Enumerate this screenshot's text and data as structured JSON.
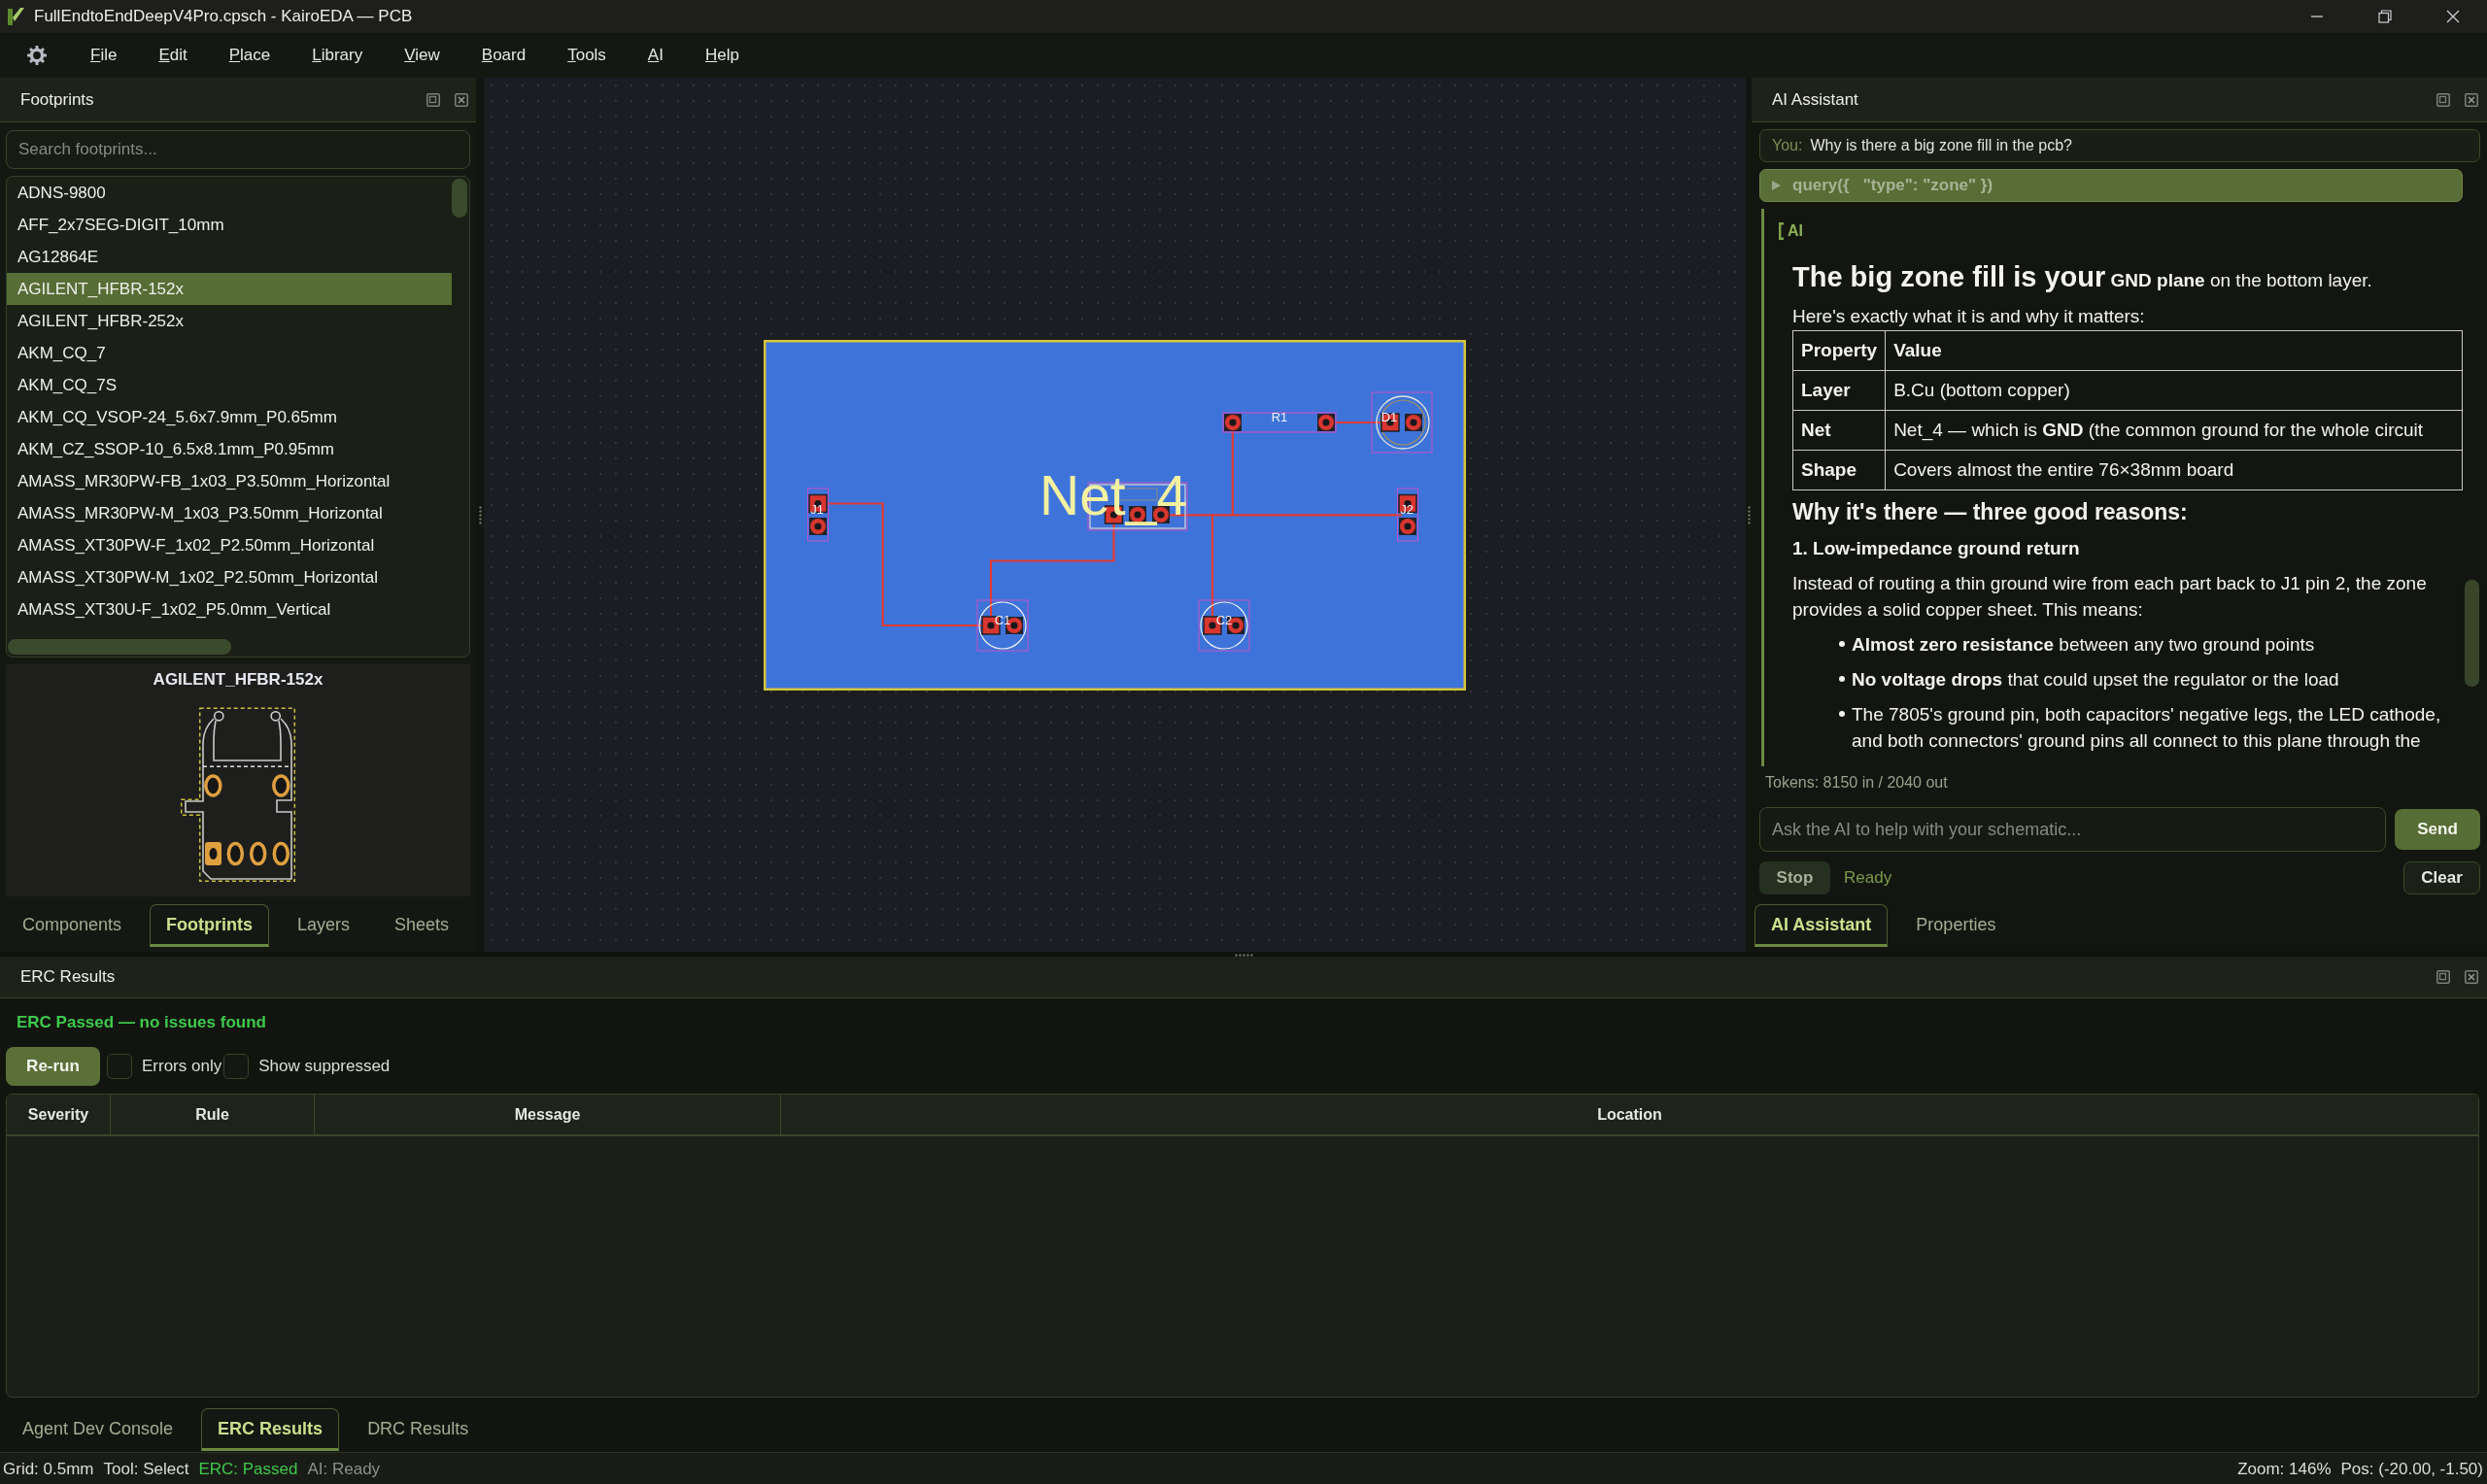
{
  "window": {
    "title": "FullEndtoEndDeepV4Pro.cpsch - KairoEDA — PCB"
  },
  "menu": [
    "File",
    "Edit",
    "Place",
    "Library",
    "View",
    "Board",
    "Tools",
    "AI",
    "Help"
  ],
  "footprints_panel": {
    "title": "Footprints",
    "search": {
      "placeholder": "Search footprints..."
    },
    "items": [
      {
        "label": "ADNS-9800",
        "selected": false
      },
      {
        "label": "AFF_2x7SEG-DIGIT_10mm",
        "selected": false
      },
      {
        "label": "AG12864E",
        "selected": false
      },
      {
        "label": "AGILENT_HFBR-152x",
        "selected": true
      },
      {
        "label": "AGILENT_HFBR-252x",
        "selected": false
      },
      {
        "label": "AKM_CQ_7",
        "selected": false
      },
      {
        "label": "AKM_CQ_7S",
        "selected": false
      },
      {
        "label": "AKM_CQ_VSOP-24_5.6x7.9mm_P0.65mm",
        "selected": false
      },
      {
        "label": "AKM_CZ_SSOP-10_6.5x8.1mm_P0.95mm",
        "selected": false
      },
      {
        "label": "AMASS_MR30PW-FB_1x03_P3.50mm_Horizontal",
        "selected": false
      },
      {
        "label": "AMASS_MR30PW-M_1x03_P3.50mm_Horizontal",
        "selected": false
      },
      {
        "label": "AMASS_XT30PW-F_1x02_P2.50mm_Horizontal",
        "selected": false
      },
      {
        "label": "AMASS_XT30PW-M_1x02_P2.50mm_Horizontal",
        "selected": false
      },
      {
        "label": "AMASS_XT30U-F_1x02_P5.0mm_Vertical",
        "selected": false
      }
    ],
    "preview": {
      "title": "AGILENT_HFBR-152x"
    },
    "tabs": [
      {
        "label": "Components",
        "selected": false
      },
      {
        "label": "Footprints",
        "selected": true
      },
      {
        "label": "Layers",
        "selected": false
      },
      {
        "label": "Sheets",
        "selected": false
      }
    ]
  },
  "pcb_canvas": {
    "net_label": "Net_4",
    "components": [
      {
        "ref": "R1",
        "kind": "resistor"
      },
      {
        "ref": "D1",
        "kind": "led"
      },
      {
        "ref": "J1",
        "kind": "connector"
      },
      {
        "kind": "regulator"
      },
      {
        "ref": "J2",
        "kind": "connector"
      },
      {
        "ref": "C1",
        "kind": "capacitor"
      },
      {
        "ref": "C2",
        "kind": "capacitor"
      }
    ]
  },
  "ai_panel": {
    "title": "AI Assistant",
    "user_message": {
      "speaker": "You:",
      "text": "Why is there a big zone fill in the pcb?"
    },
    "tool_call": {
      "text": "query({   \"type\": \"zone\" })",
      "expanded": false
    },
    "reply": {
      "speaker": "AI",
      "heading": {
        "lead": "The big zone fill is your",
        "rest": "**GND plane** on the bottom layer."
      },
      "intro": "Here's exactly what it is and why it matters:",
      "table": {
        "columns": [
          "Property",
          "Value"
        ],
        "rows": [
          [
            "Layer",
            "B.Cu (bottom copper)"
          ],
          [
            "Net",
            "Net_4 — which is **GND** (the common ground for the whole circuit"
          ],
          [
            "Shape",
            "Covers almost the entire 76×38mm board"
          ]
        ]
      },
      "section_title": "Why it's there — three good reasons:",
      "point_title": "1. Low-impedance ground return",
      "paragraph": "Instead of routing a thin ground wire from each part back to J1 pin 2, the zone provides a solid copper sheet. This means:",
      "bullets": [
        "**Almost zero resistance** between any two ground points",
        "**No voltage drops** that could upset the regulator or the load",
        "The 7805's ground pin, both capacitors' negative legs, the LED cathode, and both connectors' ground pins all connect to this plane through the"
      ]
    },
    "tokens": "Tokens: 8150 in / 2040 out",
    "input": {
      "placeholder": "Ask the AI to help with your schematic..."
    },
    "send_button": "Send",
    "stop_button": {
      "label": "Stop",
      "disabled": true
    },
    "status": "Ready",
    "clear_button": "Clear",
    "tabs": [
      {
        "label": "AI Assistant",
        "selected": true
      },
      {
        "label": "Properties",
        "selected": false
      }
    ]
  },
  "erc_panel": {
    "title": "ERC Results",
    "summary": "ERC Passed — no issues found",
    "rerun_button": "Re-run",
    "filters": [
      {
        "label": "Errors only",
        "checked": false
      },
      {
        "label": "Show suppressed",
        "checked": false
      }
    ],
    "table": {
      "columns": [
        "Severity",
        "Rule",
        "Message",
        "Location"
      ]
    },
    "tabs": [
      {
        "label": "Agent Dev Console",
        "selected": false
      },
      {
        "label": "ERC Results",
        "selected": true
      },
      {
        "label": "DRC Results",
        "selected": false
      }
    ]
  },
  "status_bar": {
    "left": [
      {
        "text": "Grid: 0.5mm",
        "kind": "plain"
      },
      {
        "text": "Tool: Select",
        "kind": "plain"
      },
      {
        "text": "ERC: Passed",
        "kind": "ok"
      },
      {
        "text": "AI: Ready",
        "kind": "muted"
      }
    ],
    "right": [
      {
        "text": "Zoom: 146%"
      },
      {
        "text": "Pos: (-20.00, -1.50)"
      }
    ]
  }
}
